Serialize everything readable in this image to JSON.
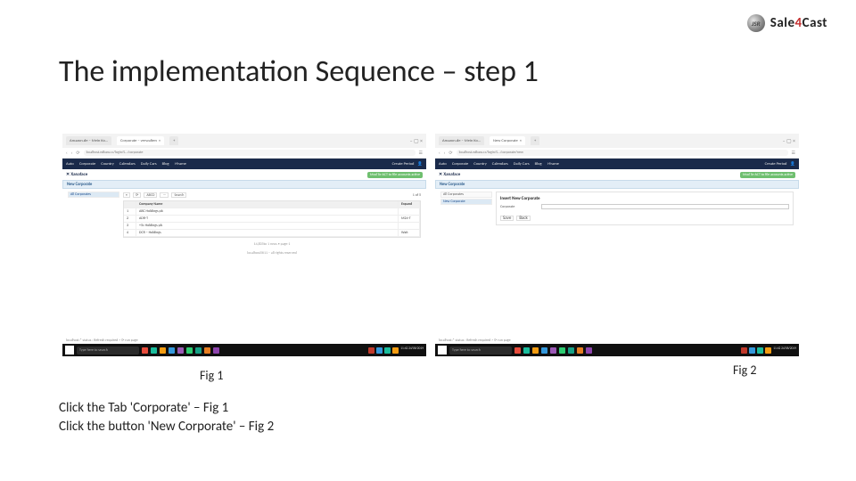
{
  "brand": {
    "initials": "JSR",
    "name_a": "Sale",
    "name_b": "4",
    "name_c": "Cast"
  },
  "title": "The implementation Sequence – step 1",
  "captions": {
    "fig1": "Fig 1",
    "fig2": "Fig 2"
  },
  "instructions": {
    "line1": "Click the Tab 'Corporate' – Fig 1",
    "line2": "Click the button 'New Corporate' – Fig 2"
  },
  "fig1": {
    "tab_a": "Amazon.de – Mein Ko…",
    "tab_b": "Corporate – verwalten",
    "win_label": "– ▢ ×",
    "url": "localhost.ndbaw.cc/login/S…/corporate",
    "addr_right": "☰",
    "appmenu": [
      "Auto",
      "Corporate",
      "Country",
      "Calendars",
      "Daily Cars",
      "Blog",
      "I-frame"
    ],
    "appright": [
      "Create Period",
      "👤"
    ],
    "logo_text": "✕ Xanaface",
    "green_status": "Mod To-ACT to file  accounts active",
    "panel_label": "New Corporate",
    "side": [
      "All Corporates"
    ],
    "tbuttons": [
      "≡",
      "⟳",
      "ABCD",
      "⋯",
      "Search"
    ],
    "page_info": "1 of 5",
    "headers": [
      "",
      "Company Name",
      "Expand"
    ],
    "rows": [
      {
        "num": "1",
        "name": "ABC Holdings plc",
        "act": ""
      },
      {
        "num": "2",
        "name": "ADR-T",
        "act": "M24-T"
      },
      {
        "num": "3",
        "name": "+5c Holdings plc",
        "act": ""
      },
      {
        "num": "4",
        "name": "DCR – Holdings",
        "act": "Wait"
      }
    ],
    "grid_footer": "14,835to 1 rows • page 1",
    "copyright": "localhost5611 – all rights reserved",
    "desk_text": "localhost:*  status : Refresh required > ⟳ run page",
    "search_placeholder": "Type here to search",
    "clock": "11:42\n24/06/2019"
  },
  "fig2": {
    "tab_a": "Amazon.de – Mein Ko…",
    "tab_b": "New Corporate",
    "win_label": "– ▢ ×",
    "url": "localhost.ndbaw.cc/login/S…/corporate/new",
    "addr_right": "☰",
    "appmenu": [
      "Auto",
      "Corporate",
      "Country",
      "Calendars",
      "Daily Cars",
      "Blog",
      "I-frame"
    ],
    "appright": [
      "Create Period",
      "👤"
    ],
    "logo_text": "✕ Xanaface",
    "green_status": "Mod To-ACT to file  accounts active",
    "panel_label": "New Corporate",
    "side": [
      "All Corporates",
      "New Corporate"
    ],
    "form_title": "Insert New Corporate",
    "field_label": "Corporate",
    "buttons": [
      "Save",
      "Back"
    ],
    "desk_text": "localhost:*  status : Refresh required > ⟳ run page",
    "search_placeholder": "Type here to search",
    "clock": "11:42\n24/06/2019"
  }
}
